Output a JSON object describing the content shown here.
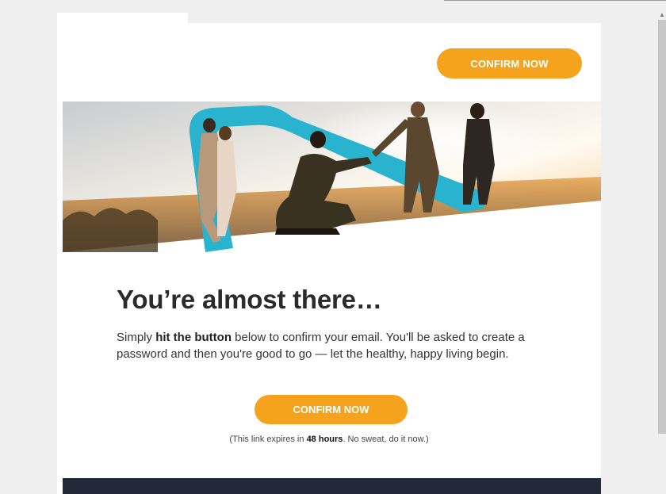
{
  "header": {
    "button_label": "CONFIRM NOW"
  },
  "hero": {
    "image_name": "group-of-friends-at-sunset"
  },
  "content": {
    "headline": "You’re almost there…",
    "body_pre": "Simply ",
    "body_bold": "hit the button",
    "body_post": " below to confirm your email. You'll be asked to create a password and then you're good to go — let the healthy, happy living begin."
  },
  "cta": {
    "button_label": "CONFIRM NOW"
  },
  "expiry": {
    "pre": "(This link expires in ",
    "bold": "48 hours",
    "post": ". No sweat, do it now.)"
  },
  "colors": {
    "accent": "#f5a21d",
    "ribbon": "#2ab3cf",
    "footer": "#222a3a"
  },
  "scrollbar": {
    "arrow_icon": "scroll-up-arrow-icon"
  }
}
